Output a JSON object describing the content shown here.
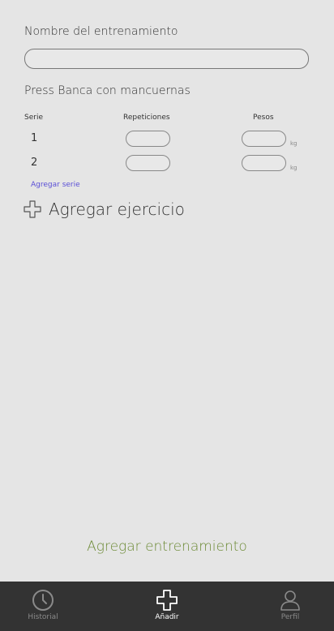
{
  "form": {
    "name_label": "Nombre del entrenamiento",
    "name_value": ""
  },
  "exercise": {
    "title": "Press Banca con mancuernas",
    "columns": {
      "serie": "Serie",
      "reps": "Repeticiones",
      "weight": "Pesos"
    },
    "sets": [
      {
        "number": "1",
        "reps": "",
        "weight": "",
        "unit": "kg"
      },
      {
        "number": "2",
        "reps": "",
        "weight": "",
        "unit": "kg"
      }
    ],
    "add_set_label": "Agregar serie"
  },
  "add_exercise_label": "Agregar ejercicio",
  "submit_label": "Agregar entrenamiento",
  "nav": {
    "items": [
      {
        "label": "Historial",
        "icon": "clock-icon",
        "active": false
      },
      {
        "label": "Añadir",
        "icon": "plus-icon",
        "active": true
      },
      {
        "label": "Perfil",
        "icon": "user-icon",
        "active": false
      }
    ]
  },
  "colors": {
    "background": "#e5e5e5",
    "nav_background": "#333333",
    "link": "#5a4fd6",
    "submit": "#6c8a35"
  }
}
